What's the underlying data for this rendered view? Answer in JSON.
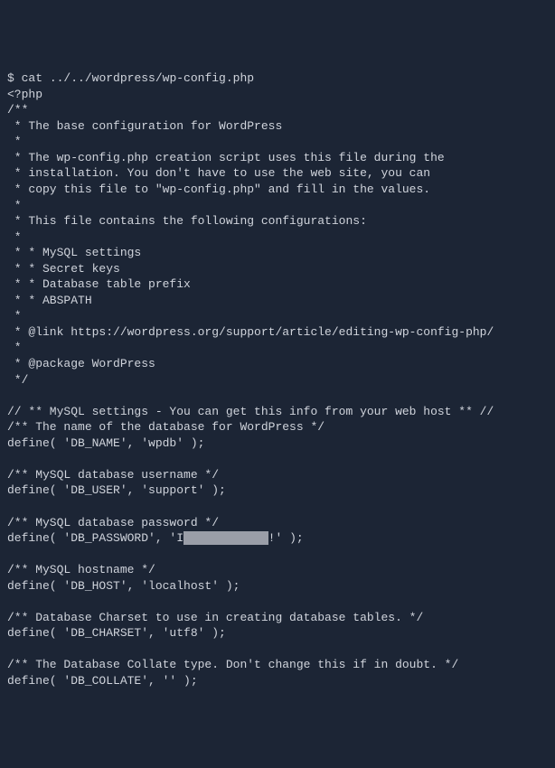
{
  "prompt": "$",
  "command": "cat ../../wordpress/wp-config.php",
  "lines": [
    "<?php",
    "/**",
    " * The base configuration for WordPress",
    " *",
    " * The wp-config.php creation script uses this file during the",
    " * installation. You don't have to use the web site, you can",
    " * copy this file to \"wp-config.php\" and fill in the values.",
    " *",
    " * This file contains the following configurations:",
    " *",
    " * * MySQL settings",
    " * * Secret keys",
    " * * Database table prefix",
    " * * ABSPATH",
    " *",
    " * @link https://wordpress.org/support/article/editing-wp-config-php/",
    " *",
    " * @package WordPress",
    " */",
    "",
    "// ** MySQL settings - You can get this info from your web host ** //",
    "/** The name of the database for WordPress */",
    "define( 'DB_NAME', 'wpdb' );",
    "",
    "/** MySQL database username */",
    "define( 'DB_USER', 'support' );",
    "",
    "/** MySQL database password */"
  ],
  "password_line": {
    "prefix": "define( 'DB_PASSWORD', 'I",
    "redacted": "████████████",
    "suffix": "!' );"
  },
  "lines_after": [
    "",
    "/** MySQL hostname */",
    "define( 'DB_HOST', 'localhost' );",
    "",
    "/** Database Charset to use in creating database tables. */",
    "define( 'DB_CHARSET', 'utf8' );",
    "",
    "/** The Database Collate type. Don't change this if in doubt. */",
    "define( 'DB_COLLATE', '' );"
  ]
}
